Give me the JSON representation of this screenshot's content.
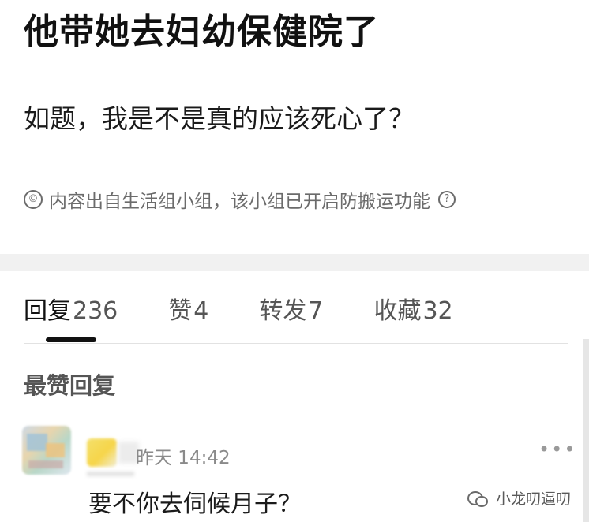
{
  "post": {
    "title": "他带她去妇幼保健院了",
    "body": "如题，我是不是真的应该死心了？",
    "source_notice": "内容出自生活组小组，该小组已开启防搬运功能",
    "source_icon": "copyright-circle-icon",
    "help_icon_glyph": "?"
  },
  "tabs": [
    {
      "label": "回复",
      "count": "236",
      "active": true
    },
    {
      "label": "赞",
      "count": "4",
      "active": false
    },
    {
      "label": "转发",
      "count": "7",
      "active": false
    },
    {
      "label": "收藏",
      "count": "32",
      "active": false
    }
  ],
  "replies": {
    "section_title": "最赞回复",
    "items": [
      {
        "time": "昨天 14:42",
        "text": "要不你去伺候月子？",
        "more_glyph": "•••"
      }
    ]
  },
  "watermark": {
    "text": "小龙叨逼叨",
    "icon": "wechat-icon"
  },
  "colors": {
    "text_primary": "#111111",
    "text_secondary": "#6b6b6b",
    "separator": "#f1f1f1"
  }
}
